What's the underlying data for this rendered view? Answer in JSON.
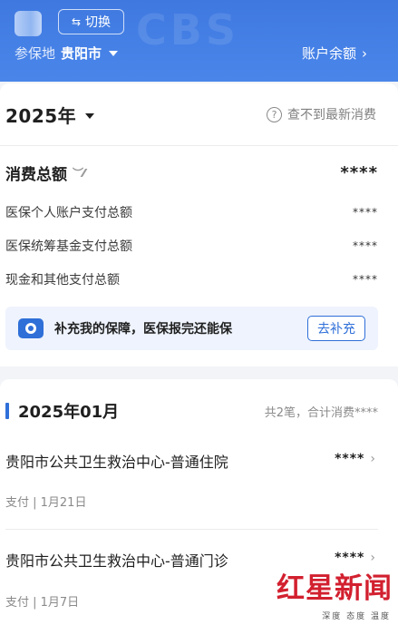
{
  "header": {
    "switch_label": "切换",
    "location_label": "参保地",
    "city": "贵阳市",
    "balance_label": "账户余额",
    "watermark": "CBS"
  },
  "summary": {
    "year": "2025年",
    "no_latest": "查不到最新消费",
    "total_title": "消费总额",
    "total_value": "****",
    "rows": [
      {
        "label": "医保个人账户支付总额",
        "value": "****"
      },
      {
        "label": "医保统筹基金支付总额",
        "value": "****"
      },
      {
        "label": "现金和其他支付总额",
        "value": "****"
      }
    ],
    "banner_text": "补充我的保障，医保报完还能保",
    "banner_button": "去补充"
  },
  "month": {
    "title": "2025年01月",
    "summary": "共2笔，合计消费****",
    "records": [
      {
        "name": "贵阳市公共卫生救治中心-普通住院",
        "amount": "****",
        "meta": "支付  |  1月21日"
      },
      {
        "name": "贵阳市公共卫生救治中心-普通门诊",
        "amount": "****",
        "meta": "支付  |  1月7日"
      }
    ]
  },
  "logo": {
    "big": "红星新闻",
    "small": "深度 态度 温度"
  },
  "colors": {
    "header_blue": "#4a86ea",
    "accent_blue": "#2f6fd8",
    "logo_red": "#d2202f"
  }
}
